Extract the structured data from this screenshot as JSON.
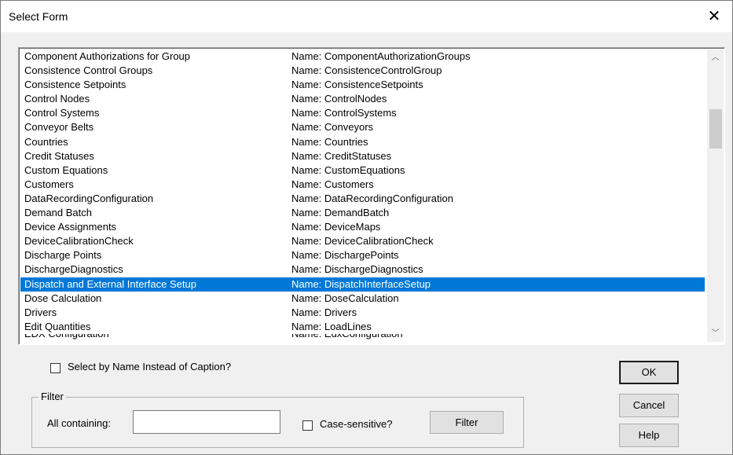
{
  "dialog": {
    "title": "Select Form",
    "close_symbol": "✕"
  },
  "list": {
    "selected_index": 16,
    "items": [
      {
        "caption": "Component Authorizations for Group",
        "name": "Name: ComponentAuthorizationGroups"
      },
      {
        "caption": "Consistence Control Groups",
        "name": "Name: ConsistenceControlGroup"
      },
      {
        "caption": "Consistence Setpoints",
        "name": "Name: ConsistenceSetpoints"
      },
      {
        "caption": "Control Nodes",
        "name": "Name: ControlNodes"
      },
      {
        "caption": "Control Systems",
        "name": "Name: ControlSystems"
      },
      {
        "caption": "Conveyor Belts",
        "name": "Name: Conveyors"
      },
      {
        "caption": "Countries",
        "name": "Name: Countries"
      },
      {
        "caption": "Credit Statuses",
        "name": "Name: CreditStatuses"
      },
      {
        "caption": "Custom Equations",
        "name": "Name: CustomEquations"
      },
      {
        "caption": "Customers",
        "name": "Name: Customers"
      },
      {
        "caption": "DataRecordingConfiguration",
        "name": "Name: DataRecordingConfiguration"
      },
      {
        "caption": "Demand Batch",
        "name": "Name: DemandBatch"
      },
      {
        "caption": "Device Assignments",
        "name": "Name: DeviceMaps"
      },
      {
        "caption": "DeviceCalibrationCheck",
        "name": "Name: DeviceCalibrationCheck"
      },
      {
        "caption": "Discharge Points",
        "name": "Name: DischargePoints"
      },
      {
        "caption": "DischargeDiagnostics",
        "name": "Name: DischargeDiagnostics"
      },
      {
        "caption": "Dispatch and External Interface Setup",
        "name": "Name: DispatchInterfaceSetup"
      },
      {
        "caption": "Dose Calculation",
        "name": "Name: DoseCalculation"
      },
      {
        "caption": "Drivers",
        "name": "Name: Drivers"
      },
      {
        "caption": "Edit Quantities",
        "name": "Name: LoadLines"
      },
      {
        "caption": "EDX Configuration",
        "name": "Name: EdxConfiguration"
      }
    ],
    "scroll_up_icon": "chevron-up",
    "scroll_down_icon": "chevron-down",
    "scroll_up_glyph": "︿",
    "scroll_down_glyph": "﹀"
  },
  "options": {
    "select_by_name_label": "Select by Name Instead of Caption?",
    "select_by_name_checked": false
  },
  "filter": {
    "group_label": "Filter",
    "all_containing_label": "All containing:",
    "all_containing_value": "",
    "case_sensitive_label": "Case-sensitive?",
    "case_sensitive_checked": false,
    "filter_button_label": "Filter"
  },
  "buttons": {
    "ok_label": "OK",
    "cancel_label": "Cancel",
    "help_label": "Help"
  }
}
